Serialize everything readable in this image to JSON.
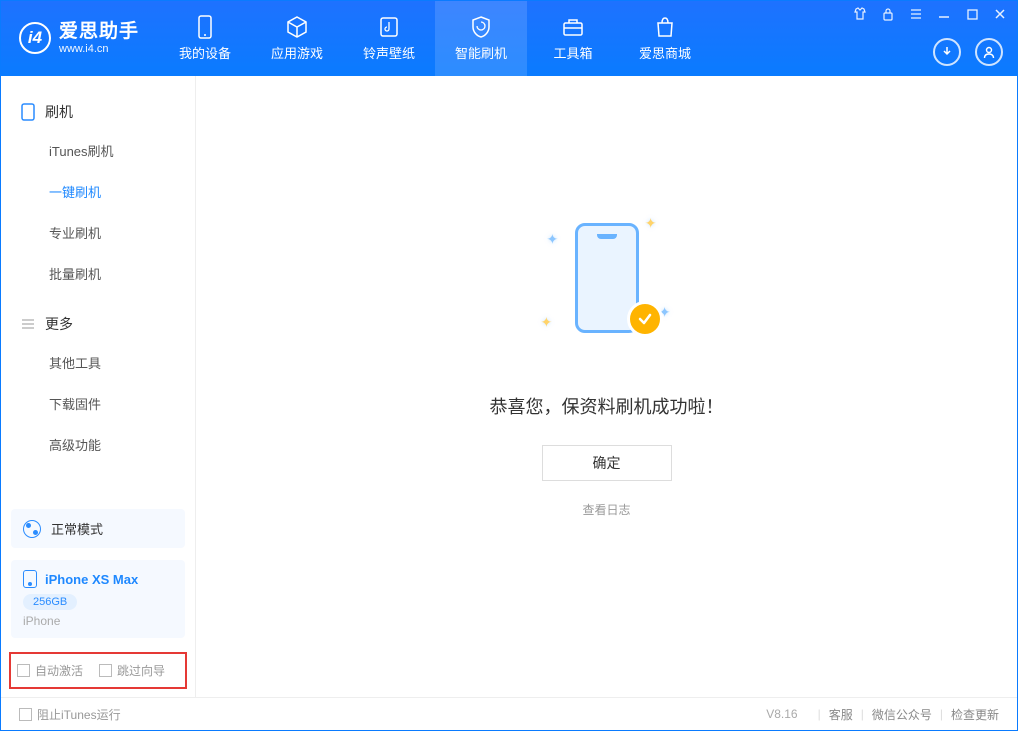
{
  "app": {
    "name": "爱思助手",
    "url": "www.i4.cn"
  },
  "nav": {
    "items": [
      {
        "label": "我的设备"
      },
      {
        "label": "应用游戏"
      },
      {
        "label": "铃声壁纸"
      },
      {
        "label": "智能刷机"
      },
      {
        "label": "工具箱"
      },
      {
        "label": "爱思商城"
      }
    ]
  },
  "sidebar": {
    "group1": {
      "title": "刷机",
      "items": [
        "iTunes刷机",
        "一键刷机",
        "专业刷机",
        "批量刷机"
      ]
    },
    "group2": {
      "title": "更多",
      "items": [
        "其他工具",
        "下载固件",
        "高级功能"
      ]
    },
    "mode": "正常模式",
    "device": {
      "name": "iPhone XS Max",
      "storage": "256GB",
      "type": "iPhone"
    },
    "opts": {
      "auto_activate": "自动激活",
      "skip_guide": "跳过向导"
    }
  },
  "main": {
    "success": "恭喜您，保资料刷机成功啦！",
    "ok": "确定",
    "view_log": "查看日志"
  },
  "status": {
    "block_itunes": "阻止iTunes运行",
    "version": "V8.16",
    "links": [
      "客服",
      "微信公众号",
      "检查更新"
    ]
  }
}
